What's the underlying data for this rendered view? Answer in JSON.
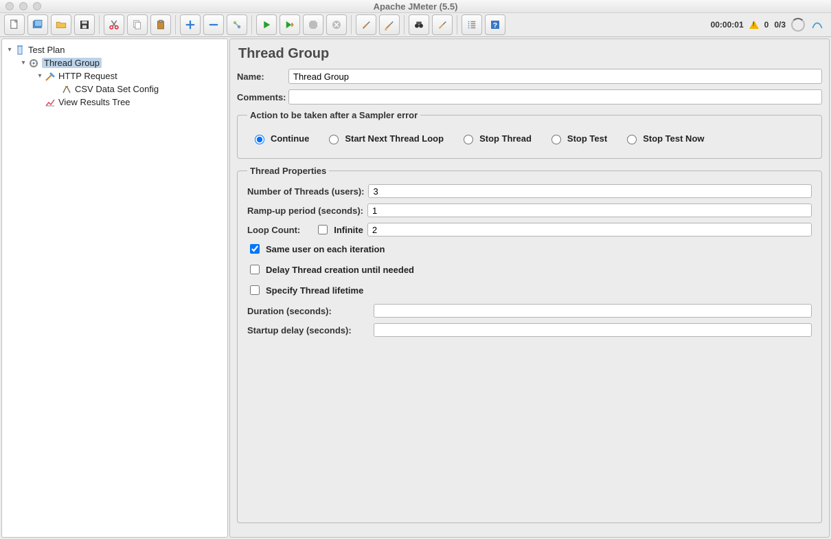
{
  "window": {
    "title": "Apache JMeter (5.5)"
  },
  "toolbar": {
    "buttons": [
      {
        "name": "new-file-icon"
      },
      {
        "name": "templates-icon"
      },
      {
        "name": "open-icon"
      },
      {
        "name": "save-icon"
      },
      {
        "name": "cut-icon"
      },
      {
        "name": "copy-icon"
      },
      {
        "name": "paste-icon"
      },
      {
        "name": "expand-icon"
      },
      {
        "name": "collapse-icon"
      },
      {
        "name": "toggle-icon"
      },
      {
        "name": "start-icon"
      },
      {
        "name": "start-no-timers-icon"
      },
      {
        "name": "stop-icon"
      },
      {
        "name": "shutdown-icon"
      },
      {
        "name": "clear-icon"
      },
      {
        "name": "clear-all-icon"
      },
      {
        "name": "search-icon"
      },
      {
        "name": "reset-search-icon"
      },
      {
        "name": "function-helper-icon"
      },
      {
        "name": "help-icon"
      }
    ]
  },
  "status": {
    "elapsed": "00:00:01",
    "warnings": "0",
    "threads": "0/3"
  },
  "tree": {
    "root": {
      "label": "Test Plan"
    },
    "threadGroup": {
      "label": "Thread Group"
    },
    "httpRequest": {
      "label": "HTTP Request"
    },
    "csvConfig": {
      "label": "CSV Data Set Config"
    },
    "viewResults": {
      "label": "View Results Tree"
    }
  },
  "detail": {
    "heading": "Thread Group",
    "name_label": "Name:",
    "name_value": "Thread Group",
    "comments_label": "Comments:",
    "comments_value": "",
    "actionLegend": "Action to be taken after a Sampler error",
    "radios": {
      "continue": "Continue",
      "startNext": "Start Next Thread Loop",
      "stopThread": "Stop Thread",
      "stopTest": "Stop Test",
      "stopTestNow": "Stop Test Now"
    },
    "threadPropsLegend": "Thread Properties",
    "numThreads_label": "Number of Threads (users):",
    "numThreads_value": "3",
    "rampUp_label": "Ramp-up period (seconds):",
    "rampUp_value": "1",
    "loopCount_label": "Loop Count:",
    "loopInfinite_label": "Infinite",
    "loopCount_value": "2",
    "sameUser_label": "Same user on each iteration",
    "delayThread_label": "Delay Thread creation until needed",
    "specifyLifetime_label": "Specify Thread lifetime",
    "duration_label": "Duration (seconds):",
    "duration_value": "",
    "startupDelay_label": "Startup delay (seconds):",
    "startupDelay_value": ""
  }
}
